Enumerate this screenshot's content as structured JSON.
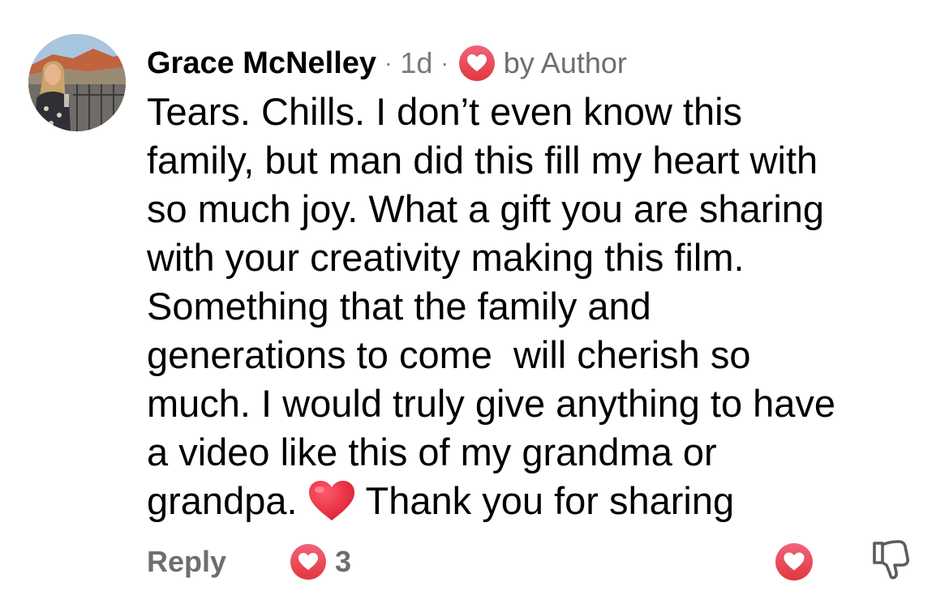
{
  "comment": {
    "author": "Grace McNelley",
    "separator_1": "·",
    "timestamp": "1d",
    "separator_2": "·",
    "author_badge_label": "by Author",
    "body_lines": [
      "Tears. Chills. I don’t even know this",
      "family, but man did this fill my heart with",
      "so much joy. What a gift you are sharing",
      "with your creativity making this film.",
      "Something that the family and",
      "generations to come  will cherish so",
      "much. I would truly give anything to have",
      "a video like this of my grandma or"
    ],
    "last_line_before_emoji": "grandpa.",
    "last_line_after_emoji": "Thank you for sharing"
  },
  "footer": {
    "reply_label": "Reply",
    "like_count": "3"
  },
  "icons": {
    "author_badge": "heart-badge-icon",
    "inline_emoji": "red-heart-emoji-icon",
    "like_count": "heart-badge-icon",
    "like_button": "heart-badge-icon",
    "dislike_button": "thumbs-down-icon"
  },
  "colors": {
    "heart_gradient_top": "#f2637b",
    "heart_gradient_bottom": "#e0383e",
    "secondary_text": "#6e6e6e",
    "emoji_red": "#e5243b"
  }
}
